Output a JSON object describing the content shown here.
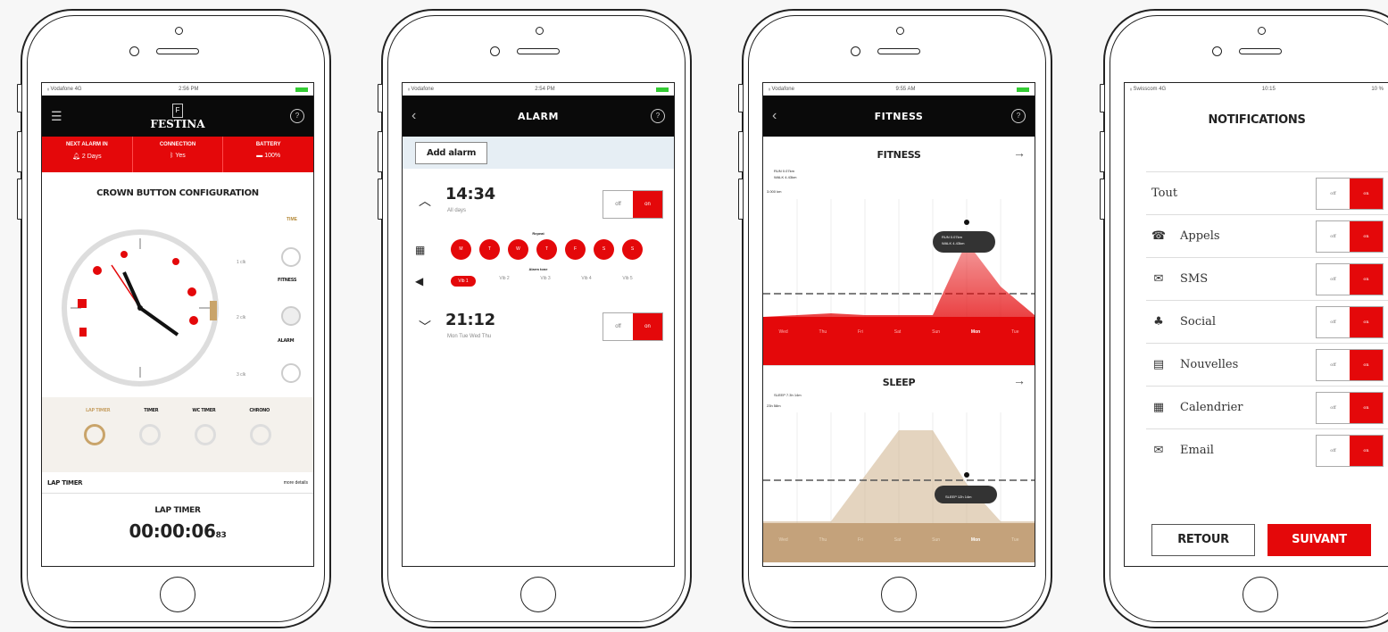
{
  "phone1": {
    "status": {
      "carrier": "ᵢᵢ Vodafone  4G",
      "time": "2:56 PM"
    },
    "brand": "FESTINA",
    "help": "?",
    "redbar": [
      {
        "label": "NEXT ALARM IN",
        "value": "2 Days"
      },
      {
        "label": "CONNECTION",
        "value": "Yes"
      },
      {
        "label": "BATTERY",
        "value": "100%"
      }
    ],
    "title": "CROWN BUTTON CONFIGURATION",
    "time_label": "TIME",
    "clicks": [
      {
        "count": "1 clk",
        "label": "FITNESS"
      },
      {
        "count": "2 clk",
        "label": "ALARM"
      },
      {
        "count": "3 clk",
        "label": ""
      }
    ],
    "modes": [
      "LAP TIMER",
      "TIMER",
      "WC TIMER",
      "CHRONO"
    ],
    "section_label": "LAP TIMER",
    "more": "more details",
    "timer_label": "LAP TIMER",
    "timer_value": "00:00:06",
    "timer_frac": "83"
  },
  "phone2": {
    "status": {
      "carrier": "ᵢᵢ Vodafone",
      "time": "2:54 PM"
    },
    "title": "ALARM",
    "help": "?",
    "add_alarm": "Add alarm",
    "alarm1": {
      "time": "14:34",
      "days": "All days",
      "off": "off",
      "on": "on"
    },
    "repeat_label": "Repeat",
    "days": [
      "M",
      "T",
      "W",
      "T",
      "F",
      "S",
      "S"
    ],
    "tone_label": "Alarm tone",
    "tones": [
      "Vib 1",
      "Vib 2",
      "Vib 3",
      "Vib 4",
      "Vib 5"
    ],
    "alarm2": {
      "time": "21:12",
      "days": "Mon Tue Wed Thu",
      "off": "off",
      "on": "on"
    }
  },
  "phone3": {
    "status": {
      "carrier": "ᵢᵢ Vodafone",
      "time": "9:55 AM"
    },
    "title": "FITNESS",
    "help": "?",
    "fitness": {
      "title": "FITNESS",
      "legend": [
        "RUN 0.07km",
        "WALK 4.43km"
      ],
      "goal": "3.000 km",
      "tooltip": [
        "RUN 0.07km",
        "WALK 4.43km"
      ],
      "days": [
        "Wed",
        "Thu",
        "Fri",
        "Sat",
        "Sun",
        "Mon",
        "Tue"
      ]
    },
    "sleep": {
      "title": "SLEEP",
      "legend": "SLEEP 7.3h 14m",
      "goal": "23h 58m",
      "tooltip": "SLEEP 12h 14m",
      "days": [
        "Wed",
        "Thu",
        "Fri",
        "Sat",
        "Sun",
        "Mon",
        "Tue"
      ]
    }
  },
  "phone4": {
    "status": {
      "carrier": "ᵢᵢ Swisscom  4G",
      "time": "10:15",
      "right": "10 %"
    },
    "title": "NOTIFICATIONS",
    "rows": [
      {
        "icon": "",
        "label": "Tout"
      },
      {
        "icon": "☎",
        "label": "Appels"
      },
      {
        "icon": "✉",
        "label": "SMS"
      },
      {
        "icon": "♣",
        "label": "Social"
      },
      {
        "icon": "▤",
        "label": "Nouvelles"
      },
      {
        "icon": "▦",
        "label": "Calendrier"
      },
      {
        "icon": "✉",
        "label": "Email"
      }
    ],
    "off": "off",
    "on": "on",
    "back_btn": "RETOUR",
    "next_btn": "SUIVANT"
  }
}
